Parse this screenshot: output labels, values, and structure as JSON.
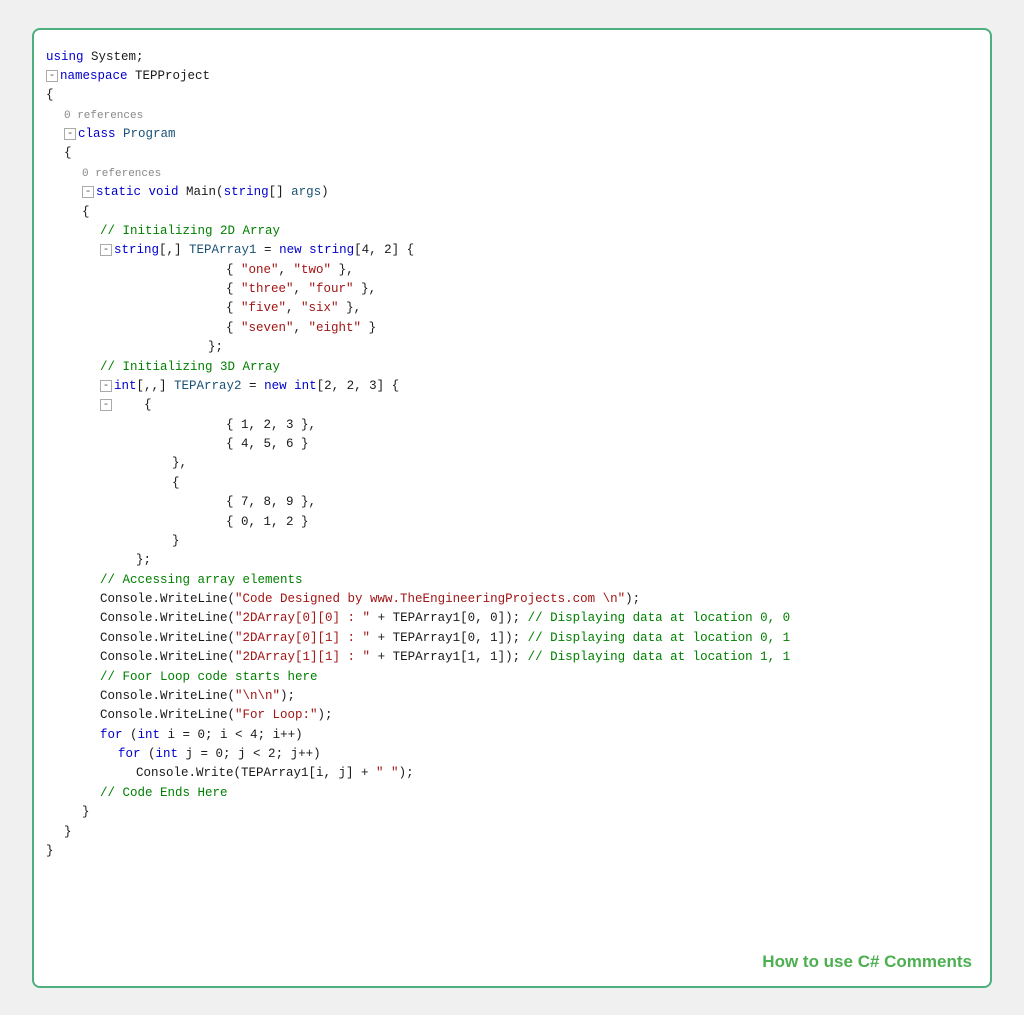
{
  "title": "How to use C# Comments",
  "code": {
    "lines": [
      {
        "indent": 0,
        "content": "using System;",
        "type": "plain",
        "tokens": [
          {
            "t": "kw",
            "v": "using"
          },
          {
            "t": "plain",
            "v": " System;"
          }
        ]
      },
      {
        "indent": 0,
        "content": "",
        "type": "blank"
      },
      {
        "indent": 0,
        "content": "⊟namespace TEPProject",
        "type": "ns",
        "tokens": [
          {
            "t": "collapse",
            "v": "⊟"
          },
          {
            "t": "kw",
            "v": "namespace"
          },
          {
            "t": "plain",
            "v": " TEPProject"
          }
        ]
      },
      {
        "indent": 0,
        "content": "{",
        "type": "plain"
      },
      {
        "indent": 1,
        "content": "0 references",
        "type": "ref"
      },
      {
        "indent": 1,
        "content": "⊟class Program",
        "type": "class",
        "tokens": [
          {
            "t": "collapse",
            "v": "⊟"
          },
          {
            "t": "kw",
            "v": "class"
          },
          {
            "t": "plain",
            "v": " "
          },
          {
            "t": "var",
            "v": "Program"
          }
        ]
      },
      {
        "indent": 1,
        "content": "{",
        "type": "plain"
      },
      {
        "indent": 2,
        "content": "0 references",
        "type": "ref"
      },
      {
        "indent": 2,
        "content": "⊟static void Main(string[] args)",
        "type": "method"
      },
      {
        "indent": 2,
        "content": "{",
        "type": "plain"
      },
      {
        "indent": 3,
        "content": "// Initializing 2D Array",
        "type": "comment"
      },
      {
        "indent": 3,
        "content": "⊟string[,] TEPArray1 = new string[4, 2] {",
        "type": "code"
      },
      {
        "indent": 7,
        "content": "{ \"one\", \"two\" },",
        "type": "string-line"
      },
      {
        "indent": 7,
        "content": "{ \"three\", \"four\" },",
        "type": "string-line"
      },
      {
        "indent": 7,
        "content": "{ \"five\", \"six\" },",
        "type": "string-line"
      },
      {
        "indent": 7,
        "content": "{ \"seven\", \"eight\" }",
        "type": "string-line"
      },
      {
        "indent": 6,
        "content": "};",
        "type": "plain"
      },
      {
        "indent": 0,
        "content": "",
        "type": "blank"
      },
      {
        "indent": 3,
        "content": "// Initializing 3D Array",
        "type": "comment"
      },
      {
        "indent": 3,
        "content": "⊟int[,,] TEPArray2 = new int[2, 2, 3] {",
        "type": "code"
      },
      {
        "indent": 3,
        "content": "⊟    {",
        "type": "code2"
      },
      {
        "indent": 0,
        "content": "",
        "type": "blank"
      },
      {
        "indent": 7,
        "content": "{ 1, 2, 3 },",
        "type": "plain"
      },
      {
        "indent": 7,
        "content": "{ 4, 5, 6 }",
        "type": "plain"
      },
      {
        "indent": 5,
        "content": "},",
        "type": "plain"
      },
      {
        "indent": 5,
        "content": "{",
        "type": "plain"
      },
      {
        "indent": 0,
        "content": "",
        "type": "blank"
      },
      {
        "indent": 7,
        "content": "{ 7, 8, 9 },",
        "type": "plain"
      },
      {
        "indent": 7,
        "content": "{ 0, 1, 2 }",
        "type": "plain"
      },
      {
        "indent": 5,
        "content": "}",
        "type": "plain"
      },
      {
        "indent": 4,
        "content": "};",
        "type": "plain"
      },
      {
        "indent": 0,
        "content": "",
        "type": "blank"
      },
      {
        "indent": 3,
        "content": "// Accessing array elements",
        "type": "comment"
      },
      {
        "indent": 3,
        "content": "Console.WriteLine(\"Code Designed by www.TheEngineeringProjects.com \\n\");",
        "type": "console"
      },
      {
        "indent": 3,
        "content": "Console.WriteLine(\"2DArray[0][0] : \" + TEPArray1[0, 0]); // Displaying data at location 0, 0",
        "type": "console-comment"
      },
      {
        "indent": 3,
        "content": "Console.WriteLine(\"2DArray[0][1] : \" + TEPArray1[0, 1]); // Displaying data at location 0, 1",
        "type": "console-comment"
      },
      {
        "indent": 3,
        "content": "Console.WriteLine(\"2DArray[1][1] : \" + TEPArray1[1, 1]); // Displaying data at location 1, 1",
        "type": "console-comment"
      },
      {
        "indent": 0,
        "content": "",
        "type": "blank"
      },
      {
        "indent": 3,
        "content": "// Foor Loop code starts here",
        "type": "comment"
      },
      {
        "indent": 3,
        "content": "Console.WriteLine(\"\\n\\n\");",
        "type": "console"
      },
      {
        "indent": 3,
        "content": "Console.WriteLine(\"For Loop:\");",
        "type": "console"
      },
      {
        "indent": 3,
        "content": "for (int i = 0; i < 4; i++)",
        "type": "code"
      },
      {
        "indent": 4,
        "content": "for (int j = 0; j < 2; j++)",
        "type": "code"
      },
      {
        "indent": 5,
        "content": "Console.Write(TEPArray1[i, j] + \" \");",
        "type": "console"
      },
      {
        "indent": 0,
        "content": "",
        "type": "blank"
      },
      {
        "indent": 3,
        "content": "// Code Ends Here",
        "type": "comment"
      },
      {
        "indent": 0,
        "content": "",
        "type": "blank"
      },
      {
        "indent": 2,
        "content": "}",
        "type": "plain"
      },
      {
        "indent": 1,
        "content": "}",
        "type": "plain"
      },
      {
        "indent": 0,
        "content": "}",
        "type": "plain"
      }
    ]
  },
  "footer": "How to use C# Comments"
}
